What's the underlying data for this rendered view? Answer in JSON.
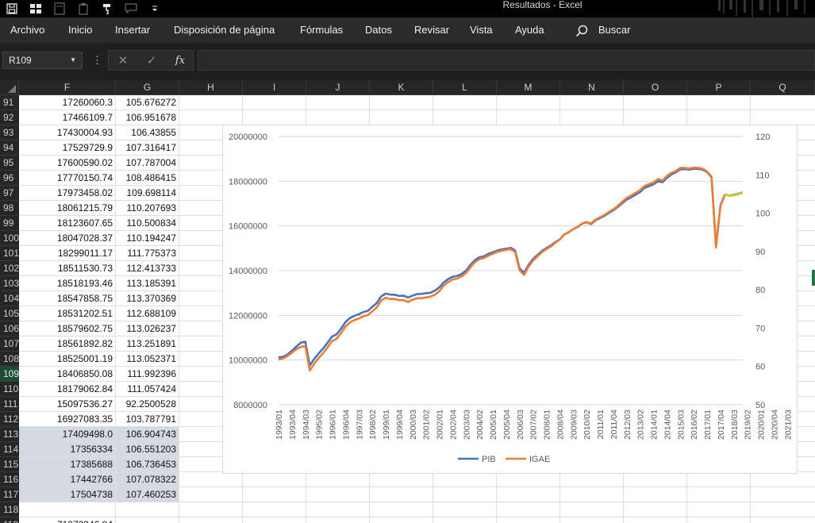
{
  "window": {
    "title": "Resultados  -  Excel"
  },
  "ribbon": {
    "tabs": [
      "Archivo",
      "Inicio",
      "Insertar",
      "Disposición de página",
      "Fórmulas",
      "Datos",
      "Revisar",
      "Vista",
      "Ayuda"
    ],
    "search_label": "Buscar"
  },
  "formula_bar": {
    "name_box": "R109",
    "fx_label": "fx",
    "value": ""
  },
  "columns": [
    "F",
    "G",
    "H",
    "I",
    "J",
    "K",
    "L",
    "M",
    "N",
    "O",
    "P",
    "Q"
  ],
  "rows": [
    {
      "n": "91",
      "f": "17260060.3",
      "g": "105.676272"
    },
    {
      "n": "92",
      "f": "17466109.7",
      "g": "106.951678"
    },
    {
      "n": "93",
      "f": "17430004.93",
      "g": "106.43855"
    },
    {
      "n": "94",
      "f": "17529729.9",
      "g": "107.316417"
    },
    {
      "n": "95",
      "f": "17600590.02",
      "g": "107.787004"
    },
    {
      "n": "96",
      "f": "17770150.74",
      "g": "108.486415"
    },
    {
      "n": "97",
      "f": "17973458.02",
      "g": "109.698114"
    },
    {
      "n": "98",
      "f": "18061215.79",
      "g": "110.207693"
    },
    {
      "n": "99",
      "f": "18123607.65",
      "g": "110.500834"
    },
    {
      "n": "100",
      "f": "18047028.37",
      "g": "110.194247"
    },
    {
      "n": "101",
      "f": "18299011.17",
      "g": "111.775373"
    },
    {
      "n": "102",
      "f": "18511530.73",
      "g": "112.413733"
    },
    {
      "n": "103",
      "f": "18518193.46",
      "g": "113.185391"
    },
    {
      "n": "104",
      "f": "18547858.75",
      "g": "113.370369"
    },
    {
      "n": "105",
      "f": "18531202.51",
      "g": "112.688109"
    },
    {
      "n": "106",
      "f": "18579602.75",
      "g": "113.026237"
    },
    {
      "n": "107",
      "f": "18561892.82",
      "g": "113.251891"
    },
    {
      "n": "108",
      "f": "18525001.19",
      "g": "113.052371"
    },
    {
      "n": "109",
      "f": "18406850.08",
      "g": "111.992396"
    },
    {
      "n": "110",
      "f": "18179062.84",
      "g": "111.057424"
    },
    {
      "n": "111",
      "f": "15097536.27",
      "g": "92.2500528"
    },
    {
      "n": "112",
      "f": "16927083.35",
      "g": "103.787791"
    },
    {
      "n": "113",
      "f": "17409498.0",
      "g": "106.904743"
    },
    {
      "n": "114",
      "f": "17356334",
      "g": "106.551203"
    },
    {
      "n": "115",
      "f": "17385688",
      "g": "106.736453"
    },
    {
      "n": "116",
      "f": "17442766",
      "g": "107.078322"
    },
    {
      "n": "117",
      "f": "17504738",
      "g": "107.460253"
    },
    {
      "n": "118",
      "f": "",
      "g": ""
    }
  ],
  "partial_row": {
    "n": "119",
    "f": "71072946.84"
  },
  "colors": {
    "pib": "#4472c4",
    "igae": "#ed7d31",
    "pib_forecast": "#00b0f0",
    "igae_forecast": "#ffc000",
    "selection": "#217346"
  },
  "chart_data": {
    "type": "line",
    "title": "",
    "y_left": {
      "min": 8000000,
      "max": 20000000,
      "ticks": [
        "8000000",
        "10000000",
        "12000000",
        "14000000",
        "16000000",
        "18000000",
        "20000000"
      ]
    },
    "y_right": {
      "min": 50,
      "max": 120,
      "ticks": [
        "50",
        "60",
        "70",
        "80",
        "90",
        "100",
        "110",
        "120"
      ]
    },
    "x_ticks": [
      "1993/01",
      "1993/04",
      "1994/03",
      "1995/02",
      "1996/01",
      "1996/04",
      "1997/03",
      "1998/02",
      "1999/01",
      "1999/04",
      "2000/03",
      "2001/02",
      "2002/01",
      "2002/04",
      "2003/03",
      "2004/02",
      "2005/01",
      "2005/04",
      "2006/03",
      "2007/02",
      "2008/01",
      "2008/04",
      "2009/03",
      "2010/02",
      "2011/01",
      "2011/04",
      "2012/03",
      "2013/02",
      "2014/01",
      "2014/04",
      "2015/03",
      "2016/02",
      "2017/01",
      "2017/04",
      "2018/03",
      "2019/02",
      "2020/01",
      "2020/04",
      "2021/03"
    ],
    "series": [
      {
        "name": "PIB",
        "axis": "left",
        "values": [
          10120000,
          10140000,
          10250000,
          10420000,
          10600000,
          10780000,
          10820000,
          9750000,
          10050000,
          10300000,
          10520000,
          10780000,
          11050000,
          11150000,
          11400000,
          11700000,
          11880000,
          11980000,
          12050000,
          12150000,
          12200000,
          12380000,
          12550000,
          12850000,
          12970000,
          12930000,
          12920000,
          12870000,
          12880000,
          12800000,
          12880000,
          12950000,
          12960000,
          12990000,
          13010000,
          13100000,
          13250000,
          13470000,
          13620000,
          13730000,
          13760000,
          13850000,
          14000000,
          14260000,
          14470000,
          14600000,
          14640000,
          14750000,
          14820000,
          14900000,
          14950000,
          14980000,
          15020000,
          14900000,
          14100000,
          13900000,
          14250000,
          14520000,
          14700000,
          14880000,
          15010000,
          15120000,
          15280000,
          15400000,
          15620000,
          15720000,
          15850000,
          15950000,
          16100000,
          16160000,
          16080000,
          16250000,
          16350000,
          16450000,
          16580000,
          16700000,
          16850000,
          17020000,
          17180000,
          17280000,
          17400000,
          17520000,
          17700000,
          17780000,
          17860000,
          18000000,
          17950000,
          18150000,
          18300000,
          18400000,
          18530000,
          18540000,
          18520000,
          18560000,
          18550000,
          18520000,
          18410000,
          18180000,
          15100000,
          16930000,
          17410000,
          17360000,
          17390000,
          17440000,
          17500000
        ]
      },
      {
        "name": "IGAE",
        "axis": "right",
        "values": [
          61.8,
          62.1,
          62.7,
          63.6,
          64.5,
          65.1,
          65.3,
          58.9,
          60.7,
          62.2,
          63.5,
          65.0,
          66.6,
          67.2,
          68.7,
          70.4,
          71.5,
          72.1,
          72.5,
          73.1,
          73.4,
          74.4,
          75.4,
          77.2,
          77.9,
          77.6,
          77.6,
          77.3,
          77.3,
          76.8,
          77.4,
          77.8,
          77.8,
          78.0,
          78.2,
          78.7,
          79.6,
          81.1,
          82.0,
          82.7,
          82.9,
          83.5,
          84.4,
          85.9,
          87.2,
          88.0,
          88.3,
          88.9,
          89.4,
          89.9,
          90.2,
          90.4,
          90.6,
          89.9,
          85.1,
          83.9,
          86.0,
          87.6,
          88.7,
          89.8,
          90.6,
          91.3,
          92.3,
          93.1,
          94.4,
          95.0,
          95.8,
          96.4,
          97.3,
          97.7,
          97.3,
          98.3,
          98.9,
          99.5,
          100.3,
          101.0,
          101.9,
          103.0,
          104.0,
          104.6,
          105.3,
          106.0,
          107.1,
          107.6,
          108.0,
          108.9,
          108.5,
          109.7,
          110.5,
          111.0,
          111.8,
          111.8,
          111.6,
          111.9,
          111.8,
          111.6,
          110.9,
          109.5,
          91.0,
          101.9,
          104.8,
          104.5,
          104.6,
          104.9,
          105.3
        ]
      }
    ],
    "forecast_from_index": 100,
    "legend": {
      "position": "bottom",
      "entries": [
        "PIB",
        "IGAE"
      ]
    }
  }
}
